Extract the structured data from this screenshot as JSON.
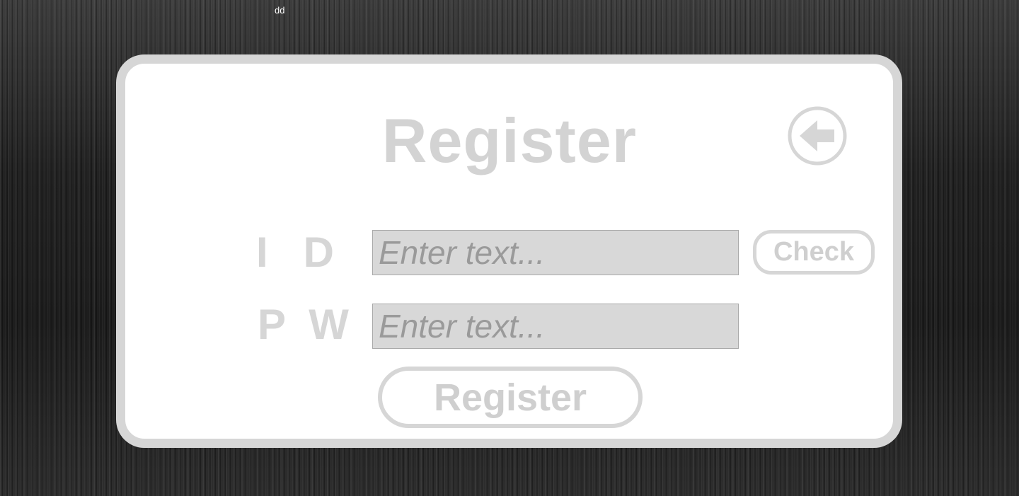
{
  "debug_text": "dd",
  "register_form": {
    "title": "Register",
    "back_icon": "arrow-left-circle-icon",
    "id_label": "I   D",
    "pw_label": "P  W",
    "id_placeholder": "Enter text...",
    "id_value": "",
    "pw_placeholder": "Enter text...",
    "pw_value": "",
    "check_label": "Check",
    "register_label": "Register"
  },
  "colors": {
    "card_background": "#ffffff",
    "card_border": "#d6d6d6",
    "muted_text": "#d3d3d3",
    "input_background": "#d8d8d8",
    "placeholder_text": "#9a9a9a"
  }
}
